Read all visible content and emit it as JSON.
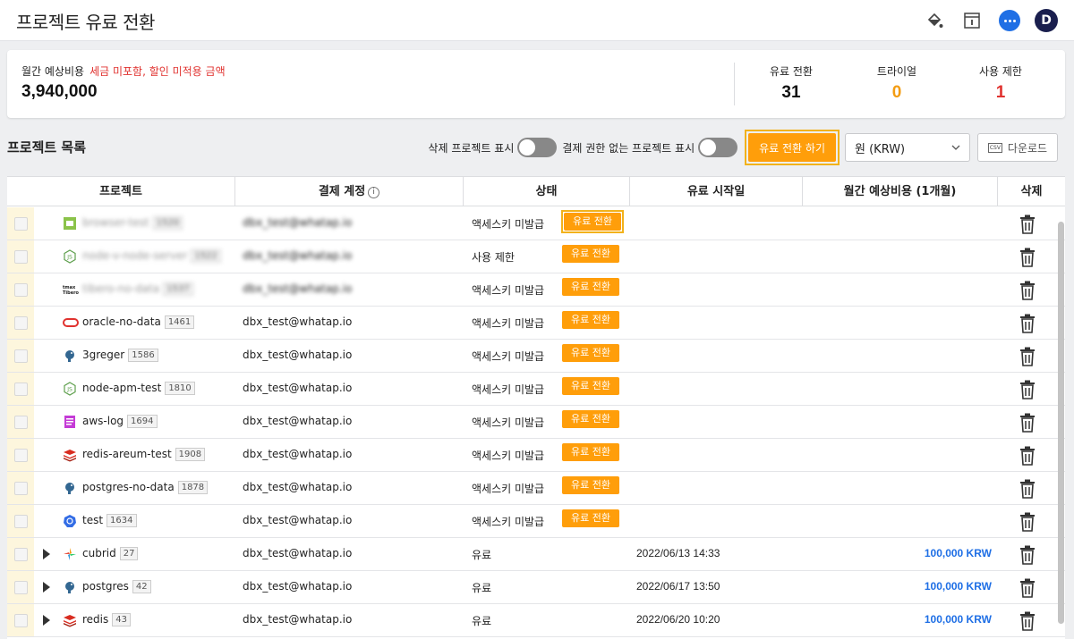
{
  "header": {
    "title": "프로젝트 유료 전환",
    "avatar_initial": "D"
  },
  "summary": {
    "label": "월간 예상비용",
    "note": "세금 미포함, 할인 미적용 금액",
    "value": "3,940,000",
    "stats": [
      {
        "label": "유료 전환",
        "value": "31",
        "color": "#111111"
      },
      {
        "label": "트라이얼",
        "value": "0",
        "color": "#f39c12"
      },
      {
        "label": "사용 제한",
        "value": "1",
        "color": "#e0322f"
      }
    ]
  },
  "toolbar": {
    "list_title": "프로젝트 목록",
    "toggle_deleted_label": "삭제 프로젝트 표시",
    "toggle_no_permission_label": "결제 권한 없는 프로젝트 표시",
    "convert_button": "유료 전환 하기",
    "currency": "원 (KRW)",
    "download": "다운로드",
    "csv_icon_text": "CSV"
  },
  "table": {
    "headers": {
      "project": "프로젝트",
      "account": "결제 계정",
      "status": "상태",
      "start": "유료 시작일",
      "cost": "월간 예상비용 (1개월)",
      "delete": "삭제"
    },
    "badge_label": "유료 전환",
    "rows": [
      {
        "icon": "browser-icon",
        "name": "browser-test",
        "code": "1520",
        "account": "dbx_test@whatap.io",
        "status": "액세스키 미발급",
        "badge": true,
        "start": "",
        "cost": "",
        "blurred": true
      },
      {
        "icon": "nodejs-icon",
        "name": "node-v-node-server",
        "code": "1522",
        "account": "dbx_test@whatap.io",
        "status": "사용 제한",
        "badge": true,
        "start": "",
        "cost": "",
        "blurred": true
      },
      {
        "icon": "tibero-icon",
        "name": "tibero-no-data",
        "code": "1537",
        "account": "dbx_test@whatap.io",
        "status": "액세스키 미발급",
        "badge": true,
        "start": "",
        "cost": "",
        "blurred": true
      },
      {
        "icon": "oracle-icon",
        "name": "oracle-no-data",
        "code": "1461",
        "account": "dbx_test@whatap.io",
        "status": "액세스키 미발급",
        "badge": true,
        "start": "",
        "cost": "",
        "blurred": false
      },
      {
        "icon": "postgres-icon",
        "name": "3greger",
        "code": "1586",
        "account": "dbx_test@whatap.io",
        "status": "액세스키 미발급",
        "badge": true,
        "start": "",
        "cost": "",
        "blurred": false
      },
      {
        "icon": "nodejs-icon",
        "name": "node-apm-test",
        "code": "1810",
        "account": "dbx_test@whatap.io",
        "status": "액세스키 미발급",
        "badge": true,
        "start": "",
        "cost": "",
        "blurred": false
      },
      {
        "icon": "aws-log-icon",
        "name": "aws-log",
        "code": "1694",
        "account": "dbx_test@whatap.io",
        "status": "액세스키 미발급",
        "badge": true,
        "start": "",
        "cost": "",
        "blurred": false
      },
      {
        "icon": "redis-icon",
        "name": "redis-areum-test",
        "code": "1908",
        "account": "dbx_test@whatap.io",
        "status": "액세스키 미발급",
        "badge": true,
        "start": "",
        "cost": "",
        "blurred": false
      },
      {
        "icon": "postgres-icon",
        "name": "postgres-no-data",
        "code": "1878",
        "account": "dbx_test@whatap.io",
        "status": "액세스키 미발급",
        "badge": true,
        "start": "",
        "cost": "",
        "blurred": false
      },
      {
        "icon": "kubernetes-icon",
        "name": "test",
        "code": "1634",
        "account": "dbx_test@whatap.io",
        "status": "액세스키 미발급",
        "badge": true,
        "start": "",
        "cost": "",
        "blurred": false
      },
      {
        "icon": "cubrid-icon",
        "name": "cubrid",
        "code": "27",
        "account": "dbx_test@whatap.io",
        "status": "유료",
        "badge": false,
        "start": "2022/06/13 14:33",
        "cost": "100,000 KRW",
        "blurred": false
      },
      {
        "icon": "postgres-icon",
        "name": "postgres",
        "code": "42",
        "account": "dbx_test@whatap.io",
        "status": "유료",
        "badge": false,
        "start": "2022/06/17 13:50",
        "cost": "100,000 KRW",
        "blurred": false
      },
      {
        "icon": "redis-icon",
        "name": "redis",
        "code": "43",
        "account": "dbx_test@whatap.io",
        "status": "유료",
        "badge": false,
        "start": "2022/06/20 10:20",
        "cost": "100,000 KRW",
        "blurred": false
      }
    ]
  }
}
